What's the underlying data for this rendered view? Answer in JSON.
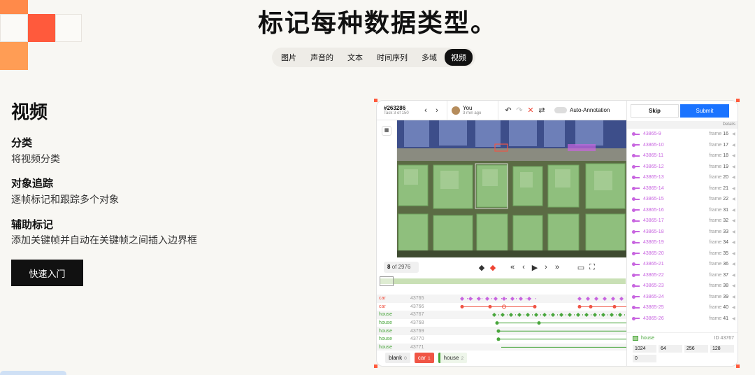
{
  "page": {
    "headline": "标记每种数据类型。",
    "tabs": [
      "图片",
      "声音的",
      "文本",
      "时间序列",
      "多域",
      "视频"
    ],
    "active_tab": "视频"
  },
  "intro": {
    "title": "视频",
    "features": [
      {
        "heading": "分类",
        "desc": "将视频分类"
      },
      {
        "heading": "对象追踪",
        "desc": "逐帧标记和跟踪多个对象"
      },
      {
        "heading": "辅助标记",
        "desc": "添加关键帧并自动在关键帧之间插入边界框"
      }
    ],
    "cta": "快速入门"
  },
  "app": {
    "task_id": "#263286",
    "task_sub": "Task 3 of 150",
    "user_name": "You",
    "user_time": "3 min ago",
    "auto_annotation": "Auto-Annotation",
    "skip": "Skip",
    "submit": "Submit",
    "details": "Details",
    "frame_current": "8",
    "frame_total": "of 2976",
    "tracks": [
      {
        "label": "car",
        "id": "43765",
        "kind": "car"
      },
      {
        "label": "car",
        "id": "43766",
        "kind": "car"
      },
      {
        "label": "house",
        "id": "43767",
        "kind": "house"
      },
      {
        "label": "house",
        "id": "43768",
        "kind": "house"
      },
      {
        "label": "house",
        "id": "43769",
        "kind": "house"
      },
      {
        "label": "house",
        "id": "43770",
        "kind": "house"
      },
      {
        "label": "house",
        "id": "43771",
        "kind": "house"
      }
    ],
    "label_pills": [
      {
        "name": "blank",
        "hotkey": "0"
      },
      {
        "name": "car",
        "hotkey": "1"
      },
      {
        "name": "house",
        "hotkey": "2"
      }
    ],
    "objects": [
      {
        "id": "43865-9",
        "frame": "16"
      },
      {
        "id": "43865-10",
        "frame": "17"
      },
      {
        "id": "43865-11",
        "frame": "18"
      },
      {
        "id": "43865-12",
        "frame": "19"
      },
      {
        "id": "43865-13",
        "frame": "20"
      },
      {
        "id": "43865-14",
        "frame": "21"
      },
      {
        "id": "43865-15",
        "frame": "22"
      },
      {
        "id": "43865-16",
        "frame": "31"
      },
      {
        "id": "43865-17",
        "frame": "32"
      },
      {
        "id": "43865-18",
        "frame": "33"
      },
      {
        "id": "43865-19",
        "frame": "34"
      },
      {
        "id": "43865-20",
        "frame": "35"
      },
      {
        "id": "43865-21",
        "frame": "36"
      },
      {
        "id": "43865-22",
        "frame": "37"
      },
      {
        "id": "43865-23",
        "frame": "38"
      },
      {
        "id": "43865-24",
        "frame": "39"
      },
      {
        "id": "43865-25",
        "frame": "40"
      },
      {
        "id": "43865-26",
        "frame": "41"
      }
    ],
    "frame_word": "frame",
    "selected": {
      "label": "house",
      "id_text": "ID 43767"
    },
    "box": {
      "x": "1024",
      "y": "64",
      "w": "256",
      "h": "128",
      "r": "0"
    },
    "coord_hints": {
      "x": "x",
      "y": "y",
      "w": "w",
      "h": "h",
      "r": "r"
    },
    "colors": {
      "accent": "#1a73ff",
      "car": "#f05545",
      "house": "#49a63c",
      "object": "#c865e0",
      "brand_orange": "#ff5a3c"
    }
  }
}
